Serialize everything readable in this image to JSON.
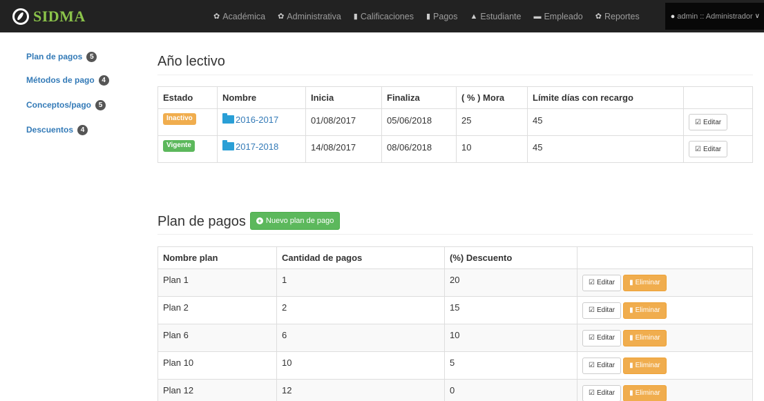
{
  "brand": {
    "name": "SIDMA"
  },
  "nav": {
    "items": [
      {
        "label": "Académica",
        "icon": "gear-icon"
      },
      {
        "label": "Administrativa",
        "icon": "gear-icon"
      },
      {
        "label": "Calificaciones",
        "icon": "file-icon"
      },
      {
        "label": "Pagos",
        "icon": "file-icon"
      },
      {
        "label": "Estudiante",
        "icon": "graduation-cap-icon"
      },
      {
        "label": "Empleado",
        "icon": "folder-icon"
      },
      {
        "label": "Reportes",
        "icon": "gear-icon"
      }
    ],
    "user": "admin :: Administrador"
  },
  "sidebar": {
    "items": [
      {
        "label": "Plan de pagos",
        "count": "5"
      },
      {
        "label": "Métodos de pago",
        "count": "4"
      },
      {
        "label": "Conceptos/pago",
        "count": "5"
      },
      {
        "label": "Descuentos",
        "count": "4"
      }
    ]
  },
  "year_section": {
    "title": "Año lectivo",
    "headers": [
      "Estado",
      "Nombre",
      "Inicia",
      "Finaliza",
      "( % ) Mora",
      "Límite días con recargo",
      ""
    ],
    "edit_label": "Editar",
    "rows": [
      {
        "status": "Inactivo",
        "status_color": "#f0ad4e",
        "name": "2016-2017",
        "start": "01/08/2017",
        "end": "05/06/2018",
        "mora": "25",
        "limit": "45"
      },
      {
        "status": "Vigente",
        "status_color": "#5cb85c",
        "name": "2017-2018",
        "start": "14/08/2017",
        "end": "08/06/2018",
        "mora": "10",
        "limit": "45"
      }
    ]
  },
  "plan_section": {
    "title": "Plan de pagos",
    "new_button": "Nuevo plan de pago",
    "headers": [
      "Nombre plan",
      "Cantidad de pagos",
      "(%) Descuento",
      ""
    ],
    "edit_label": "Editar",
    "delete_label": "Eliminar",
    "rows": [
      {
        "name": "Plan 1",
        "payments": "1",
        "discount": "20"
      },
      {
        "name": "Plan 2",
        "payments": "2",
        "discount": "15"
      },
      {
        "name": "Plan 6",
        "payments": "6",
        "discount": "10"
      },
      {
        "name": "Plan 10",
        "payments": "10",
        "discount": "5"
      },
      {
        "name": "Plan 12",
        "payments": "12",
        "discount": "0"
      }
    ]
  }
}
